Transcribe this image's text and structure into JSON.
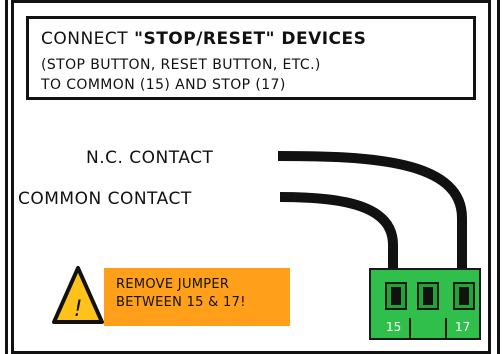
{
  "instruction": {
    "prefix": "CONNECT ",
    "highlight": "\"STOP/RESET\" DEVICES",
    "line2": "(STOP BUTTON, RESET BUTTON, ETC.)",
    "line3": "TO COMMON (15) AND STOP (17)"
  },
  "labels": {
    "nc_contact": "N.C. CONTACT",
    "common_contact": "COMMON CONTACT"
  },
  "warning": {
    "symbol": "!",
    "line1": "REMOVE JUMPER",
    "line2": "BETWEEN 15 & 17!"
  },
  "terminal": {
    "left_number": "15",
    "right_number": "17"
  },
  "colors": {
    "terminal_green": "#2fbf4a",
    "warning_orange": "#ff9f1a",
    "warning_yellow": "#ffc21a"
  }
}
